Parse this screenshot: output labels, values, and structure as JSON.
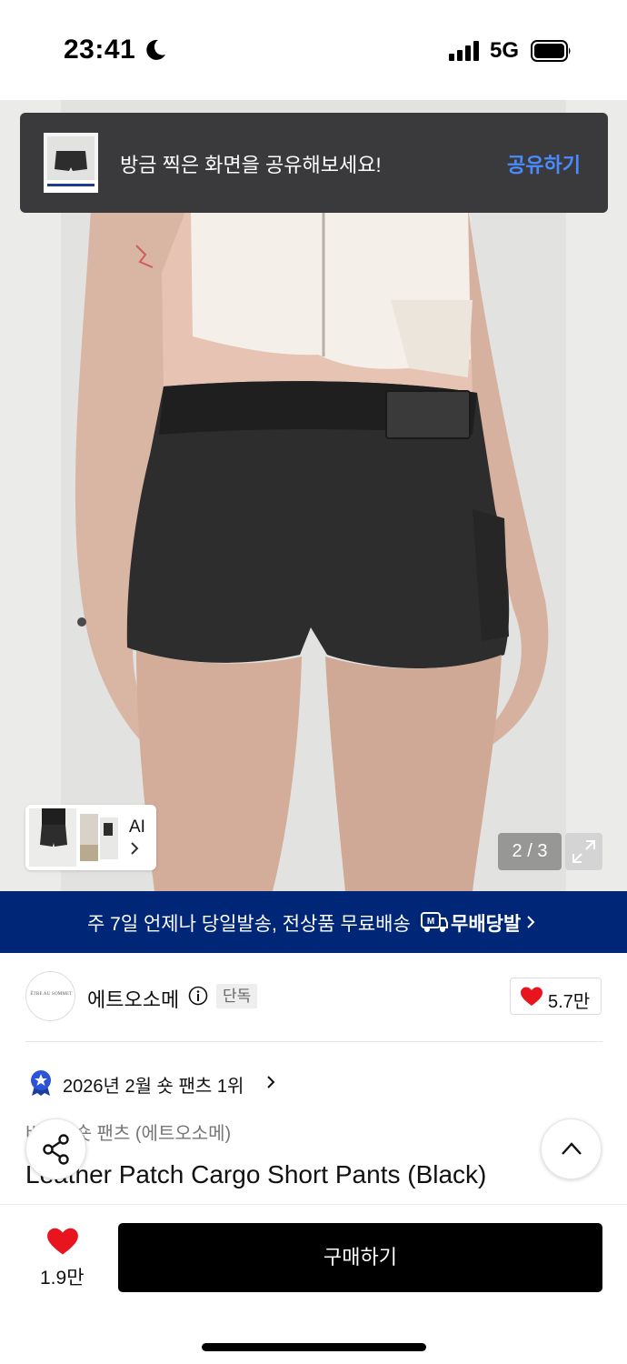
{
  "status_bar": {
    "time": "23:41",
    "network": "5G"
  },
  "toast": {
    "message": "방금 찍은 화면을 공유해보세요!",
    "action_label": "공유하기",
    "action_color": "#4a8cff"
  },
  "gallery": {
    "ai_label": "AI",
    "counter": "2 / 3"
  },
  "delivery_banner": {
    "text": "주 7일 언제나 당일발송, 전상품 무료배송",
    "brand_label": "무배당발",
    "background": "#002677"
  },
  "brand": {
    "logo_text": "ÊTRE AU SOMMET",
    "name": "에트오소메",
    "badge": "단독",
    "likes": "5.7만"
  },
  "ranking": {
    "text": "2026년 2월 숏 팬츠 1위"
  },
  "product": {
    "subtitle": "바지 · 숏 팬츠 (에트오소메)",
    "title": "Leather Patch Cargo Short Pants (Black)"
  },
  "bottom_bar": {
    "wish_count": "1.9만",
    "buy_label": "구매하기"
  },
  "icons": {
    "moon": "moon-icon",
    "signal": "signal-icon",
    "battery": "battery-icon",
    "info": "info-icon",
    "heart": "heart-icon",
    "share": "share-icon",
    "chevron_up": "chevron-up-icon",
    "expand": "expand-icon",
    "rank_badge": "rank-badge-icon"
  },
  "colors": {
    "heart": "#e8141e",
    "rank_badge": "#2b55d6"
  }
}
